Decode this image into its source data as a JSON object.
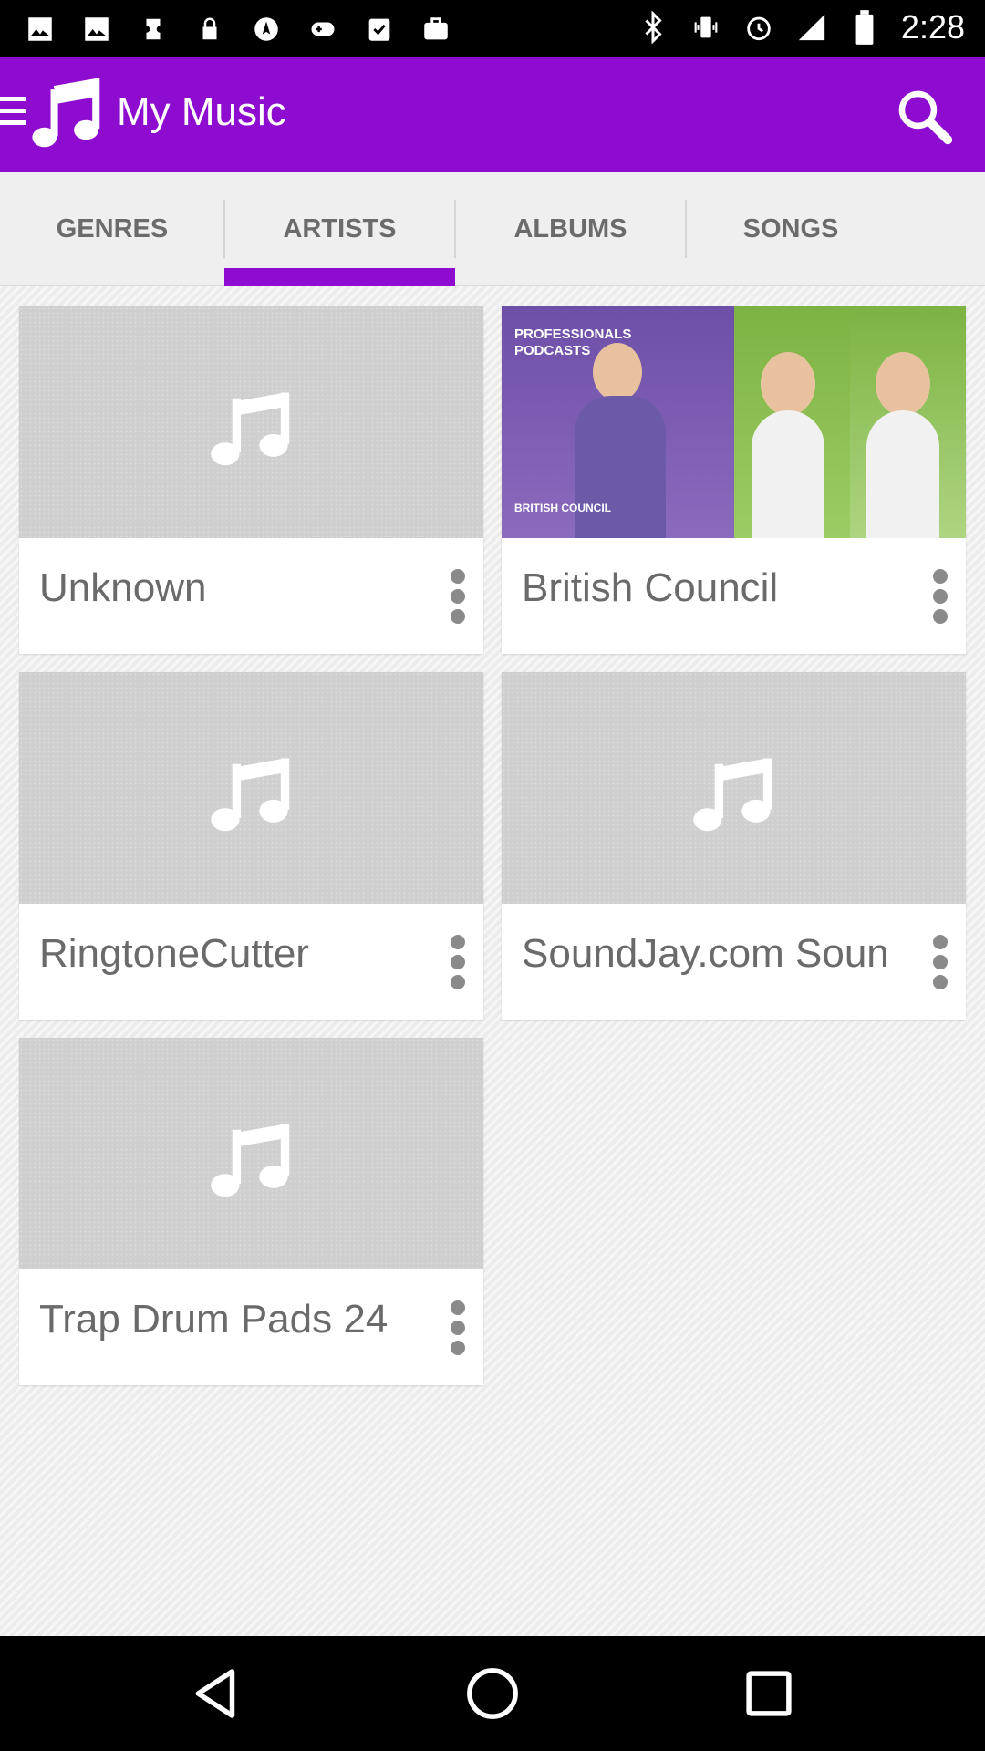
{
  "status_bar": {
    "time": "2:28",
    "left_icons": [
      "photo-icon",
      "photo-icon",
      "ticket-icon",
      "lock-icon",
      "navigation-icon",
      "gamepad-icon",
      "clipboard-check-icon",
      "briefcase-icon"
    ],
    "right_icons": [
      "bluetooth-icon",
      "vibrate-icon",
      "alarm-icon",
      "signal-icon",
      "battery-icon"
    ]
  },
  "app_bar": {
    "title": "My Music",
    "icons": [
      "menu-icon",
      "music-note-icon",
      "search-icon"
    ]
  },
  "tabs": [
    {
      "label": "GENRES",
      "selected": false
    },
    {
      "label": "ARTISTS",
      "selected": true
    },
    {
      "label": "ALBUMS",
      "selected": false
    },
    {
      "label": "SONGS",
      "selected": false
    }
  ],
  "artists": [
    {
      "name": "Unknown",
      "artwork": "music-note-icon"
    },
    {
      "name": "British Council",
      "artwork": "album-cover"
    },
    {
      "name": "RingtoneCutter",
      "artwork": "music-note-icon"
    },
    {
      "name": "SoundJay.com Soun",
      "artwork": "music-note-icon"
    },
    {
      "name": "Trap Drum Pads 24",
      "artwork": "music-note-icon"
    }
  ],
  "cover_art": {
    "caption": "PROFESSIONALS PODCASTS",
    "logo_text": "BRITISH COUNCIL"
  },
  "nav_bar": {
    "icons": [
      "back-icon",
      "home-icon",
      "recents-icon"
    ]
  },
  "colors": {
    "accent": "#8e0ccf",
    "tab_text": "#6b6b6b",
    "card_label": "#6a6a6a",
    "thumb_placeholder": "#cfcfcf"
  }
}
